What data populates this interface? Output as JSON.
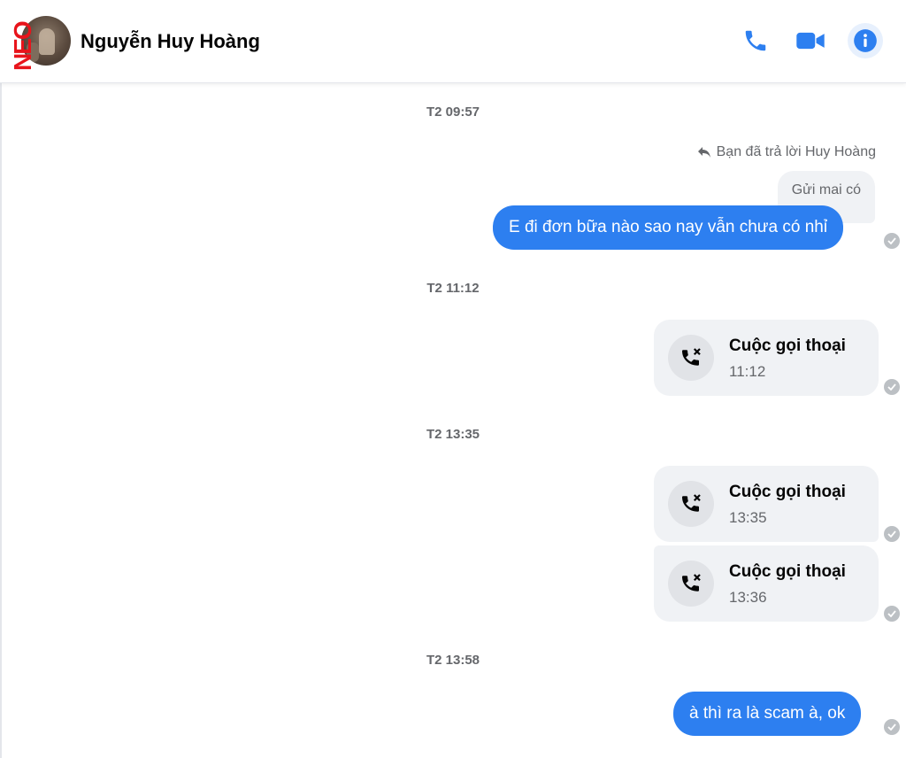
{
  "header": {
    "contact_name": "Nguyễn Huy Hoàng",
    "overlay_text": "NEO",
    "accent_color": "#2d7ff0",
    "actions": {
      "phone": "phone-icon",
      "video": "video-camera-icon",
      "info": "info-icon"
    }
  },
  "messages": {
    "timestamps": [
      "T2 09:57",
      "T2 11:12",
      "T2 13:35",
      "T2 13:58"
    ],
    "reply_context": "Bạn đã trả lời Huy Hoàng",
    "quoted_message": "Gửi mai có",
    "outgoing_1": "E đi đơn bữa nào sao nay vẫn chưa có nhỉ",
    "calls": [
      {
        "title": "Cuộc gọi thoại",
        "time": "11:12"
      },
      {
        "title": "Cuộc gọi thoại",
        "time": "13:35"
      },
      {
        "title": "Cuộc gọi thoại",
        "time": "13:36"
      }
    ],
    "outgoing_2": "à thì ra là scam à, ok"
  }
}
